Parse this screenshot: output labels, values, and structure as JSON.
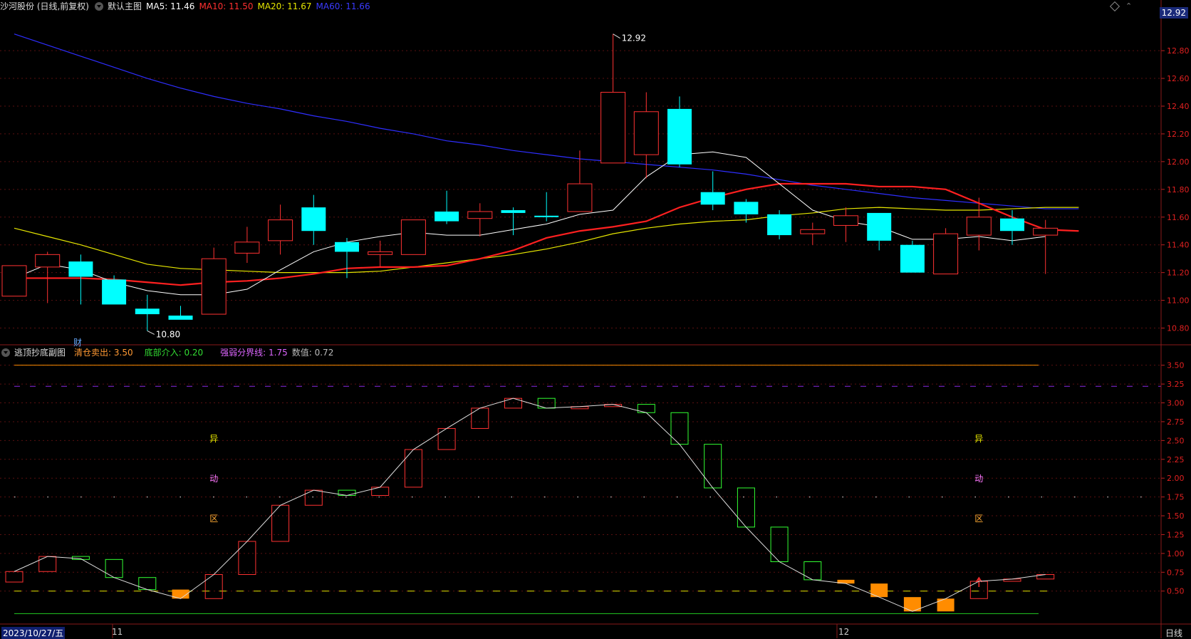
{
  "main_header": {
    "stock": "沙河股份 (日线,前复权)",
    "chart_name": "默认主图",
    "ma5": "MA5: 11.46",
    "ma10": "MA10: 11.50",
    "ma20": "MA20: 11.67",
    "ma60": "MA60: 11.66"
  },
  "sub_header": {
    "name": "逃顶抄底副图",
    "clear": "清仓卖出: 3.50",
    "bottom": "底部介入: 0.20",
    "divide": "强弱分界线: 1.75",
    "value": "数值: 0.72"
  },
  "price_badge": "12.92",
  "cai_mark": "财",
  "date_axis": {
    "start": "2023/10/27/五",
    "m11": "11",
    "m12": "12",
    "period": "日线"
  },
  "colors": {
    "up": "#ff3232",
    "down": "#00ffff",
    "ma5": "#ffffff",
    "ma10": "#ff2020",
    "ma20": "#e6e600",
    "ma60": "#2e2eff",
    "sub_up": "#ff3232",
    "sub_down": "#32ff32",
    "sub_bottom": "#ff8c00"
  },
  "chart_data": [
    {
      "type": "candlestick",
      "y_ticks": [
        "12.80",
        "12.60",
        "12.40",
        "12.20",
        "12.00",
        "11.80",
        "11.60",
        "11.40",
        "11.20",
        "11.00",
        "10.80"
      ],
      "ylim": [
        10.7,
        12.97
      ],
      "candles": [
        {
          "o": 11.03,
          "c": 11.25,
          "h": 11.25,
          "l": 11.03
        },
        {
          "o": 11.24,
          "c": 11.33,
          "h": 11.35,
          "l": 10.98
        },
        {
          "o": 11.28,
          "c": 11.17,
          "h": 11.33,
          "l": 10.97
        },
        {
          "o": 11.15,
          "c": 10.97,
          "h": 11.18,
          "l": 10.97
        },
        {
          "o": 10.94,
          "c": 10.9,
          "h": 11.04,
          "l": 10.78
        },
        {
          "o": 10.89,
          "c": 10.86,
          "h": 10.96,
          "l": 10.86
        },
        {
          "o": 10.9,
          "c": 11.3,
          "h": 11.38,
          "l": 10.9
        },
        {
          "o": 11.34,
          "c": 11.42,
          "h": 11.53,
          "l": 11.27
        },
        {
          "o": 11.43,
          "c": 11.58,
          "h": 11.69,
          "l": 11.33
        },
        {
          "o": 11.67,
          "c": 11.5,
          "h": 11.76,
          "l": 11.4
        },
        {
          "o": 11.42,
          "c": 11.35,
          "h": 11.45,
          "l": 11.16
        },
        {
          "o": 11.33,
          "c": 11.35,
          "h": 11.43,
          "l": 11.24
        },
        {
          "o": 11.33,
          "c": 11.58,
          "h": 11.58,
          "l": 11.33
        },
        {
          "o": 11.64,
          "c": 11.57,
          "h": 11.79,
          "l": 11.55
        },
        {
          "o": 11.59,
          "c": 11.64,
          "h": 11.7,
          "l": 11.46
        },
        {
          "o": 11.65,
          "c": 11.63,
          "h": 11.67,
          "l": 11.47
        },
        {
          "o": 11.61,
          "c": 11.6,
          "h": 11.78,
          "l": 11.57
        },
        {
          "o": 11.64,
          "c": 11.84,
          "h": 12.08,
          "l": 11.64
        },
        {
          "o": 11.99,
          "c": 12.5,
          "h": 12.92,
          "l": 11.99
        },
        {
          "o": 12.05,
          "c": 12.36,
          "h": 12.5,
          "l": 11.88
        },
        {
          "o": 12.38,
          "c": 11.98,
          "h": 12.47,
          "l": 11.96
        },
        {
          "o": 11.78,
          "c": 11.69,
          "h": 11.93,
          "l": 11.65
        },
        {
          "o": 11.71,
          "c": 11.62,
          "h": 11.73,
          "l": 11.56
        },
        {
          "o": 11.62,
          "c": 11.47,
          "h": 11.65,
          "l": 11.44
        },
        {
          "o": 11.48,
          "c": 11.51,
          "h": 11.56,
          "l": 11.4
        },
        {
          "o": 11.54,
          "c": 11.61,
          "h": 11.67,
          "l": 11.42
        },
        {
          "o": 11.63,
          "c": 11.43,
          "h": 11.63,
          "l": 11.36
        },
        {
          "o": 11.4,
          "c": 11.2,
          "h": 11.43,
          "l": 11.2
        },
        {
          "o": 11.19,
          "c": 11.48,
          "h": 11.52,
          "l": 11.19
        },
        {
          "o": 11.47,
          "c": 11.6,
          "h": 11.74,
          "l": 11.36
        },
        {
          "o": 11.59,
          "c": 11.5,
          "h": 11.65,
          "l": 11.4
        },
        {
          "o": 11.47,
          "c": 11.52,
          "h": 11.58,
          "l": 11.19
        }
      ],
      "ma5": [
        11.16,
        11.26,
        11.22,
        11.13,
        11.07,
        11.04,
        11.04,
        11.08,
        11.22,
        11.35,
        11.42,
        11.46,
        11.49,
        11.47,
        11.47,
        11.51,
        11.55,
        11.62,
        11.65,
        11.89,
        12.05,
        12.07,
        12.03,
        11.84,
        11.65,
        11.57,
        11.53,
        11.44,
        11.44,
        11.46,
        11.43,
        11.46
      ],
      "ma10": [
        11.16,
        11.16,
        11.16,
        11.15,
        11.13,
        11.11,
        11.13,
        11.14,
        11.16,
        11.19,
        11.23,
        11.24,
        11.24,
        11.25,
        11.3,
        11.36,
        11.45,
        11.5,
        11.53,
        11.57,
        11.67,
        11.74,
        11.8,
        11.84,
        11.84,
        11.84,
        11.82,
        11.82,
        11.8,
        11.7,
        11.6,
        11.51,
        11.5
      ],
      "ma20": [
        11.52,
        11.46,
        11.4,
        11.33,
        11.26,
        11.23,
        11.22,
        11.21,
        11.2,
        11.2,
        11.2,
        11.21,
        11.24,
        11.27,
        11.3,
        11.33,
        11.37,
        11.42,
        11.48,
        11.52,
        11.55,
        11.57,
        11.58,
        11.61,
        11.63,
        11.66,
        11.67,
        11.66,
        11.65,
        11.65,
        11.66,
        11.67,
        11.67
      ],
      "ma60": [
        12.92,
        12.84,
        12.76,
        12.68,
        12.6,
        12.53,
        12.47,
        12.42,
        12.38,
        12.33,
        12.29,
        12.24,
        12.2,
        12.15,
        12.12,
        12.08,
        12.05,
        12.02,
        12.0,
        11.98,
        11.96,
        11.94,
        11.91,
        11.87,
        11.83,
        11.8,
        11.77,
        11.74,
        11.72,
        11.7,
        11.68,
        11.66,
        11.66
      ],
      "high_label": "12.92",
      "low_label": "10.80"
    },
    {
      "type": "indicator",
      "y_ticks": [
        "3.50",
        "3.25",
        "3.00",
        "2.75",
        "2.50",
        "2.25",
        "2.00",
        "1.75",
        "1.50",
        "1.25",
        "1.00",
        "0.75",
        "0.50"
      ],
      "ylim": [
        0.1,
        3.62
      ],
      "sell_level": 3.5,
      "purple_level": 3.22,
      "divide_level": 1.75,
      "yellow_level": 0.5,
      "bottom_level": 0.2,
      "bars": [
        {
          "a": 0.62,
          "b": 0.76
        },
        {
          "a": 0.76,
          "b": 0.96
        },
        {
          "a": 0.96,
          "b": 0.92
        },
        {
          "a": 0.92,
          "b": 0.68
        },
        {
          "a": 0.68,
          "b": 0.52
        },
        {
          "a": 0.52,
          "b": 0.4
        },
        {
          "a": 0.4,
          "b": 0.72
        },
        {
          "a": 0.72,
          "b": 1.16
        },
        {
          "a": 1.16,
          "b": 1.64
        },
        {
          "a": 1.64,
          "b": 1.84
        },
        {
          "a": 1.84,
          "b": 1.77
        },
        {
          "a": 1.77,
          "b": 1.88
        },
        {
          "a": 1.88,
          "b": 2.38
        },
        {
          "a": 2.38,
          "b": 2.66
        },
        {
          "a": 2.66,
          "b": 2.93
        },
        {
          "a": 2.93,
          "b": 3.06
        },
        {
          "a": 3.06,
          "b": 2.93
        },
        {
          "a": 2.93,
          "b": 2.95
        },
        {
          "a": 2.95,
          "b": 2.98
        },
        {
          "a": 2.98,
          "b": 2.87
        },
        {
          "a": 2.87,
          "b": 2.45
        },
        {
          "a": 2.45,
          "b": 1.87
        },
        {
          "a": 1.87,
          "b": 1.35
        },
        {
          "a": 1.35,
          "b": 0.89
        },
        {
          "a": 0.89,
          "b": 0.65
        },
        {
          "a": 0.65,
          "b": 0.6
        },
        {
          "a": 0.42,
          "b": 0.6
        },
        {
          "a": 0.23,
          "b": 0.42
        },
        {
          "a": 0.23,
          "b": 0.4
        },
        {
          "a": 0.4,
          "b": 0.63
        },
        {
          "a": 0.63,
          "b": 0.66
        },
        {
          "a": 0.66,
          "b": 0.72
        }
      ],
      "orange_bars": [
        5,
        25,
        26,
        27,
        28
      ],
      "line": [
        0.76,
        0.96,
        0.93,
        0.68,
        0.52,
        0.4,
        0.72,
        1.16,
        1.64,
        1.84,
        1.77,
        1.88,
        2.38,
        2.66,
        2.93,
        3.06,
        2.93,
        2.95,
        2.98,
        2.87,
        2.45,
        1.87,
        1.35,
        0.89,
        0.65,
        0.6,
        0.42,
        0.23,
        0.4,
        0.63,
        0.66,
        0.72
      ],
      "zone1": [
        "异",
        "动",
        "区"
      ],
      "zone2": [
        "异",
        "动",
        "区"
      ]
    }
  ]
}
